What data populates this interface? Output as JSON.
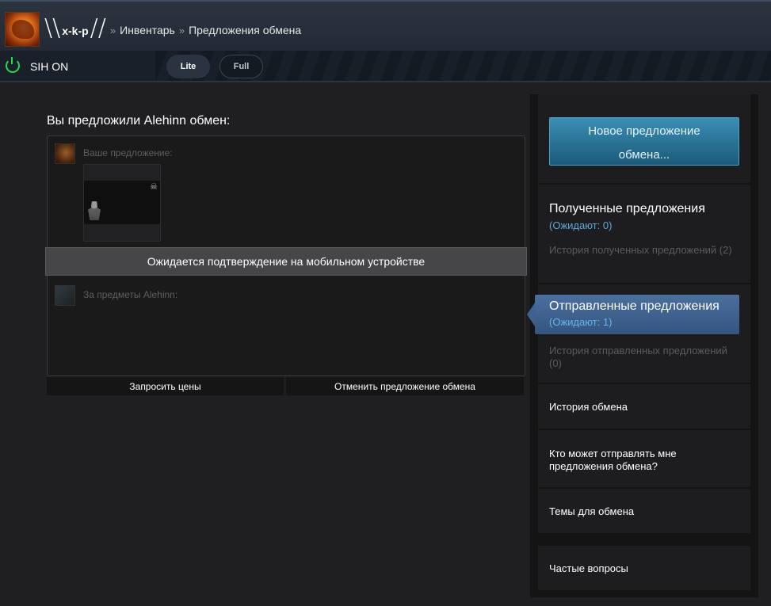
{
  "header": {
    "username": "x-k-p",
    "slash_left": "\\\\",
    "slash_right": "//",
    "separator": "»",
    "crumbs": [
      "Инвентарь",
      "Предложения обмена"
    ]
  },
  "sih": {
    "status_label": "SIH ON",
    "mode_lite": "Lite",
    "mode_full": "Full",
    "power_color": "#26d94b"
  },
  "offer": {
    "title": "Вы предложили Alehinn обмен:",
    "your_offer_label": "Ваше предложение:",
    "their_items_label": "За предметы Alehinn:",
    "pending_banner": "Ожидается подтверждение на мобильном устройстве",
    "request_prices": "Запросить цены",
    "cancel_offer": "Отменить предложение обмена",
    "item_icons": [
      "skull-icon",
      "figure-icon"
    ],
    "skull_glyph": "☠"
  },
  "sidebar": {
    "new_offer": "Новое предложение обмена...",
    "received": {
      "title": "Полученные предложения",
      "pending": "(Ожидают: 0)",
      "history": "История полученных предложений (2)"
    },
    "sent": {
      "title": "Отправленные предложения",
      "pending": "(Ожидают: 1)",
      "history": "История отправленных предложений (0)"
    },
    "trade_history": "История обмена",
    "who_can_send": "Кто может отправлять мне предложения обмена?",
    "trade_topics": "Темы для обмена",
    "faq": "Частые вопросы"
  }
}
